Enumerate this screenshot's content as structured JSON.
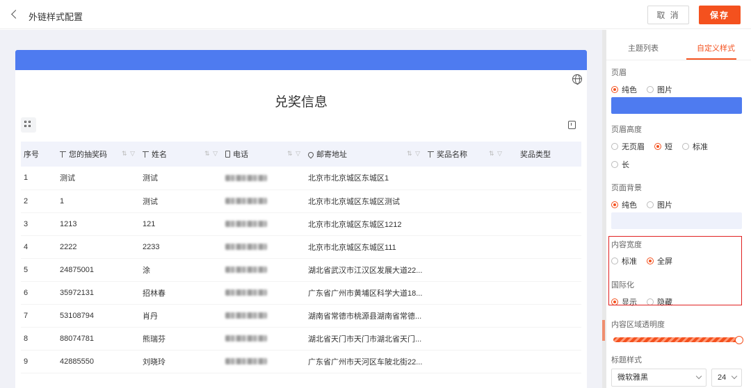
{
  "header": {
    "title": "外链样式配置",
    "cancel_label": "取 消",
    "save_label": "保存"
  },
  "preview": {
    "title": "兑奖信息",
    "header_color": "#4e7bf0",
    "columns": [
      "序号",
      "您的抽奖码",
      "姓名",
      "电话",
      "邮寄地址",
      "奖品名称",
      "奖品类型"
    ],
    "rows": [
      {
        "no": "1",
        "code": "测试",
        "name": "测试",
        "address": "北京市北京城区东城区1"
      },
      {
        "no": "2",
        "code": "1",
        "name": "测试",
        "address": "北京市北京城区东城区测试"
      },
      {
        "no": "3",
        "code": "1213",
        "name": "121",
        "address": "北京市北京城区东城区1212"
      },
      {
        "no": "4",
        "code": "2222",
        "name": "2233",
        "address": "北京市北京城区东城区111"
      },
      {
        "no": "5",
        "code": "24875001",
        "name": "涂",
        "address": "湖北省武汉市江汉区发展大道22..."
      },
      {
        "no": "6",
        "code": "35972131",
        "name": "招林春",
        "address": "广东省广州市黄埔区科学大道18..."
      },
      {
        "no": "7",
        "code": "53108794",
        "name": "肖丹",
        "address": "湖南省常德市桃源县湖南省常德..."
      },
      {
        "no": "8",
        "code": "88074781",
        "name": "熊瑞芬",
        "address": "湖北省天门市天门市湖北省天门..."
      },
      {
        "no": "9",
        "code": "42885550",
        "name": "刘晓玲",
        "address": "广东省广州市天河区车陂北街22..."
      }
    ]
  },
  "panel": {
    "tabs": [
      "主题列表",
      "自定义样式"
    ],
    "header_section": {
      "label": "页眉",
      "options": [
        "纯色",
        "图片"
      ],
      "selected": "纯色",
      "color": "#4e7bf0"
    },
    "header_height": {
      "label": "页眉高度",
      "options": [
        "无页眉",
        "短",
        "标准",
        "长"
      ],
      "selected": "短"
    },
    "page_background": {
      "label": "页面背景",
      "options": [
        "纯色",
        "图片"
      ],
      "selected": "纯色",
      "color": "#eef1fb"
    },
    "content_width": {
      "label": "内容宽度",
      "options": [
        "标准",
        "全屏"
      ],
      "selected": "全屏"
    },
    "i18n": {
      "label": "国际化",
      "options": [
        "显示",
        "隐藏"
      ],
      "selected": "显示"
    },
    "opacity": {
      "label": "内容区域透明度",
      "value": 1.0
    },
    "title_style": {
      "label": "标题样式",
      "font": "微软雅黑",
      "size": "24"
    }
  },
  "accent": "#f4511e"
}
